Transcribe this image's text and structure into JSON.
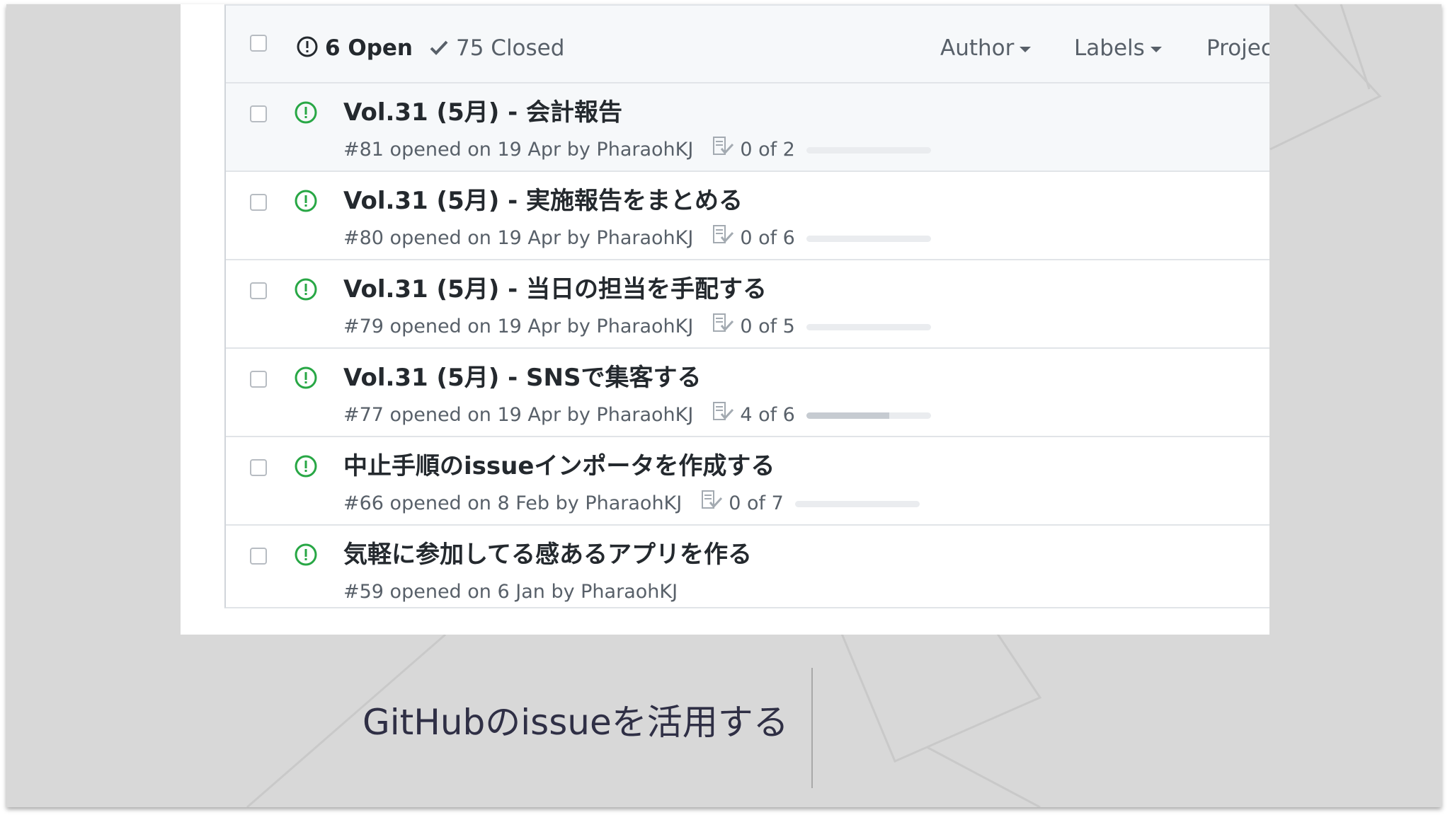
{
  "toolbar": {
    "open_label": "6 Open",
    "closed_label": "75 Closed",
    "filters": {
      "author": "Author",
      "labels": "Labels",
      "projects": "Project"
    }
  },
  "colors": {
    "open_icon": "#28a745",
    "title_text": "#24292e",
    "meta_text": "#586069",
    "header_bg": "#f6f8fa",
    "border": "#e1e4e8",
    "progress_track": "#eaecef",
    "progress_fill": "#c6cbd1",
    "slide_bg": "#d8d8d8",
    "caption_text": "#2f2f45"
  },
  "issues": [
    {
      "title": "Vol.31 (5月) - 会計報告",
      "meta": "#81 opened on 19 Apr by PharaohKJ",
      "tasks": "0 of 2",
      "progress": 0
    },
    {
      "title": "Vol.31 (5月) - 実施報告をまとめる",
      "meta": "#80 opened on 19 Apr by PharaohKJ",
      "tasks": "0 of 6",
      "progress": 0
    },
    {
      "title": "Vol.31 (5月) - 当日の担当を手配する",
      "meta": "#79 opened on 19 Apr by PharaohKJ",
      "tasks": "0 of 5",
      "progress": 0
    },
    {
      "title": "Vol.31 (5月) - SNSで集客する",
      "meta": "#77 opened on 19 Apr by PharaohKJ",
      "tasks": "4 of 6",
      "progress": 0.667
    },
    {
      "title": "中止手順のissueインポータを作成する",
      "meta": "#66 opened on 8 Feb by PharaohKJ",
      "tasks": "0 of 7",
      "progress": 0
    },
    {
      "title": "気軽に参加してる感あるアプリを作る",
      "meta": "#59 opened on 6 Jan by PharaohKJ",
      "tasks": "",
      "progress": null
    }
  ],
  "icons": {
    "issue_open": "issue-opened-icon",
    "closed_check": "check-icon",
    "tasklist": "tasklist-icon"
  },
  "caption": "GitHubのissueを活用する"
}
